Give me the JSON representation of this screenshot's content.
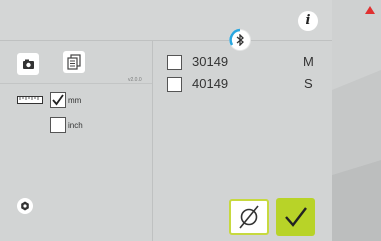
{
  "header": {
    "info_icon": "info-icon",
    "bluetooth_icon": "bluetooth-icon"
  },
  "left_panel": {
    "camera_icon": "camera-icon",
    "copy_icon": "copy-icon",
    "version": "v2.0.0",
    "ruler_icon": "ruler-icon",
    "units": [
      {
        "label": "mm",
        "checked": true
      },
      {
        "label": "inch",
        "checked": false
      }
    ],
    "bottom_icon": "settings-icon"
  },
  "list": {
    "items": [
      {
        "number": "30149",
        "size": "M",
        "checked": false
      },
      {
        "number": "40149",
        "size": "S",
        "checked": false
      }
    ]
  },
  "actions": {
    "clear_icon": "no-filter-icon",
    "confirm_icon": "checkmark-icon"
  },
  "colors": {
    "accent": "#b8d328",
    "bluetooth_arc": "#2aa7e0",
    "alert": "#e03030"
  }
}
